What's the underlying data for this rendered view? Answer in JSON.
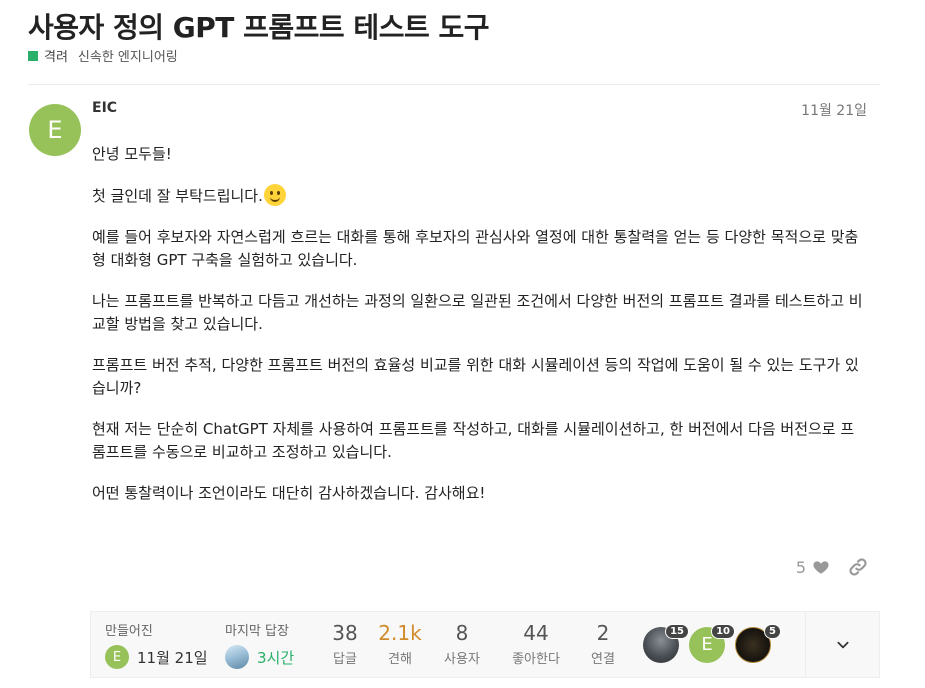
{
  "topic": {
    "title": "사용자 정의 GPT 프롬프트 테스트 도구",
    "category": "격려",
    "tag": "신속한 엔지니어링",
    "category_color": "#2ab069"
  },
  "post": {
    "avatar_letter": "E",
    "avatar_color": "#97c25a",
    "username": "EIC",
    "date": "11월 21일",
    "paragraphs": [
      "안녕 모두들!",
      "첫 글인데 잘 부탁드립니다.",
      "예를 들어 후보자와 자연스럽게 흐르는 대화를 통해 후보자의 관심사와 열정에 대한 통찰력을 얻는 등 다양한 목적으로 맞춤형 대화형 GPT 구축을 실험하고 있습니다.",
      "나는 프롬프트를 반복하고 다듬고 개선하는 과정의 일환으로 일관된 조건에서 다양한 버전의 프롬프트 결과를 테스트하고 비교할 방법을 찾고 있습니다.",
      "프롬프트 버전 추적, 다양한 프롬프트 버전의 효율성 비교를 위한 대화 시뮬레이션 등의 작업에 도움이 될 수 있는 도구가 있습니까?",
      "현재 저는 단순히 ChatGPT 자체를 사용하여 프롬프트를 작성하고, 대화를 시뮬레이션하고, 한 버전에서 다음 버전으로 프롬프트를 수동으로 비교하고 조정하고 있습니다.",
      "어떤 통찰력이나 조언이라도 대단히 감사하겠습니다. 감사해요!"
    ],
    "emoji": "slightly-smiling-face",
    "like_count": "5"
  },
  "summary": {
    "created_label": "만들어진",
    "created_date": "11월 21일",
    "last_reply_label": "마지막 답장",
    "last_reply_time": "3시간",
    "last_reply_color": "#2ab069",
    "stats": [
      {
        "num": "38",
        "label": "답글",
        "hot": false
      },
      {
        "num": "2.1k",
        "label": "견해",
        "hot": true
      },
      {
        "num": "8",
        "label": "사용자",
        "hot": false
      },
      {
        "num": "44",
        "label": "좋아한다",
        "hot": false
      },
      {
        "num": "2",
        "label": "연결",
        "hot": false
      }
    ],
    "participants": [
      {
        "badge": "15",
        "kind": "photo"
      },
      {
        "badge": "10",
        "kind": "letter",
        "letter": "E"
      },
      {
        "badge": "5",
        "kind": "dark"
      }
    ]
  }
}
